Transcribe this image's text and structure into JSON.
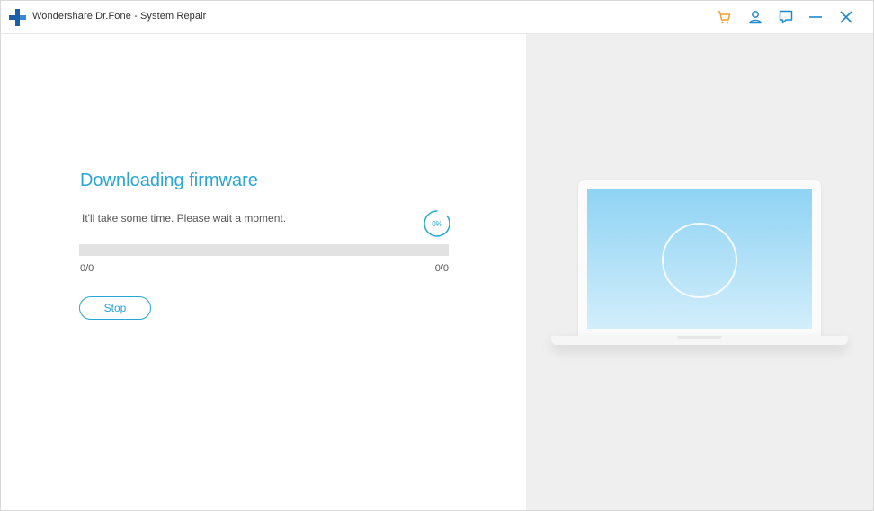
{
  "window": {
    "title": "Wondershare Dr.Fone - System Repair"
  },
  "colors": {
    "accent": "#27a6d8",
    "cart": "#f0a030",
    "icon_blue": "#1a8ad0",
    "logo": "#1c5ea8",
    "track": "#e2e2e2",
    "right_bg": "#efefef"
  },
  "titlebar_icons": [
    "cart-icon",
    "account-icon",
    "feedback-icon",
    "minimize-icon",
    "close-icon"
  ],
  "main": {
    "heading": "Downloading firmware",
    "subtitle": "It'll take some time. Please wait a moment.",
    "progress_percent_label": "0%",
    "progress_value": 0,
    "downloaded_count": "0/0",
    "total_count": "0/0",
    "stop_label": "Stop"
  }
}
